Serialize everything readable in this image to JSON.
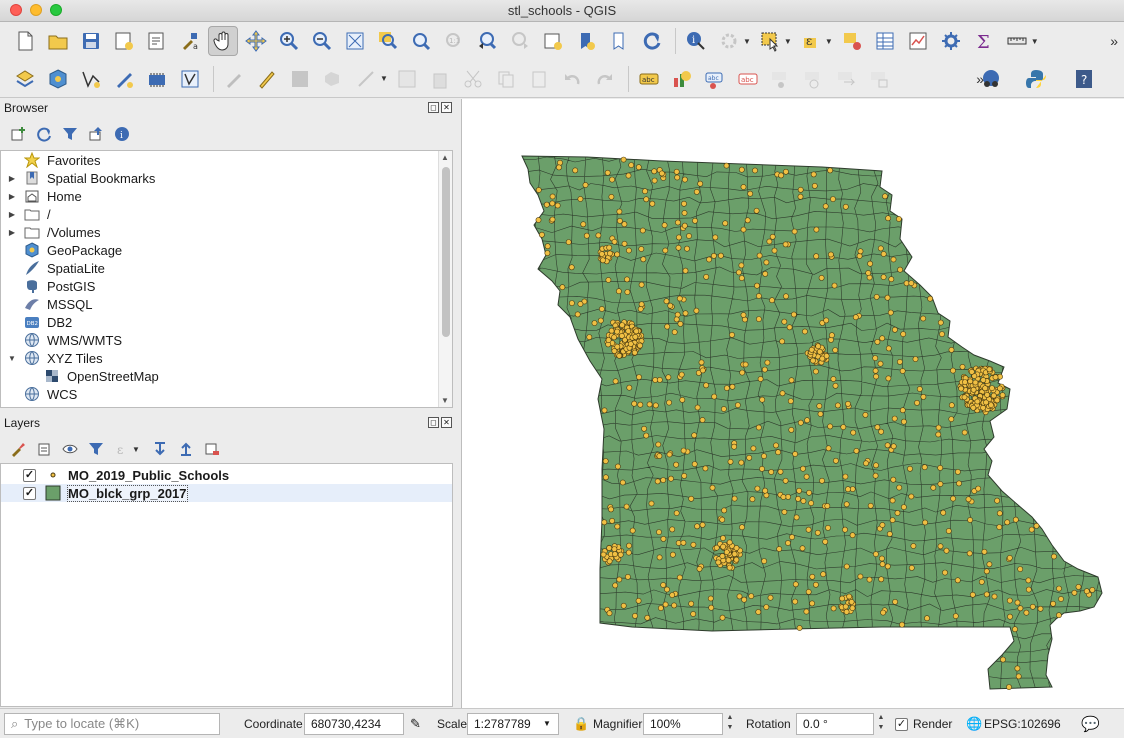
{
  "window": {
    "title": "stl_schools - QGIS"
  },
  "toolbar1": {
    "icons": [
      "new-project-icon",
      "open-project-icon",
      "save-project-icon",
      "new-print-layout-icon",
      "layout-manager-icon",
      "style-manager-icon",
      "pan-icon",
      "pan-to-selection-icon",
      "zoom-in-icon",
      "zoom-out-icon",
      "zoom-full-icon",
      "zoom-to-selection-icon",
      "zoom-to-layer-icon",
      "zoom-native-icon",
      "zoom-last-icon",
      "zoom-next-icon",
      "new-map-view-icon",
      "new-bookmark-icon",
      "show-bookmarks-icon",
      "refresh-icon",
      "identify-icon",
      "action-icon",
      "select-icon",
      "select-by-expression-icon",
      "deselect-icon",
      "attribute-table-icon",
      "statistics-icon",
      "toolbox-icon",
      "field-calculator-icon",
      "measure-icon"
    ]
  },
  "toolbar2": {
    "icons": [
      "data-source-manager-icon",
      "new-geopackage-layer-icon",
      "vertex-tool-icon",
      "digitize-icon",
      "new-temp-layer-icon",
      "virtual-layer-icon",
      "current-edits-icon",
      "toggle-editing-icon",
      "save-edits-icon",
      "add-feature-icon",
      "vertex-edit-icon",
      "modify-attributes-icon",
      "delete-selected-icon",
      "cut-icon",
      "copy-icon",
      "paste-icon",
      "undo-icon",
      "redo-icon",
      "label-icon",
      "diagram-icon",
      "pin-labels-icon",
      "highlight-pinned-icon",
      "move-label-icon",
      "rotate-label-icon",
      "change-label-icon",
      "show-hide-labels-icon",
      "plugin-icon",
      "python-icon",
      "help-icon"
    ]
  },
  "browser": {
    "title": "Browser",
    "items": [
      {
        "label": "Favorites",
        "icon": "star-icon",
        "arrow": ""
      },
      {
        "label": "Spatial Bookmarks",
        "icon": "bookmark-icon",
        "arrow": "▶"
      },
      {
        "label": "Home",
        "icon": "home-icon",
        "arrow": "▶"
      },
      {
        "label": "/",
        "icon": "folder-icon",
        "arrow": "▶"
      },
      {
        "label": "/Volumes",
        "icon": "folder-icon",
        "arrow": "▶"
      },
      {
        "label": "GeoPackage",
        "icon": "geopackage-icon",
        "arrow": ""
      },
      {
        "label": "SpatiaLite",
        "icon": "spatialite-icon",
        "arrow": ""
      },
      {
        "label": "PostGIS",
        "icon": "postgis-icon",
        "arrow": ""
      },
      {
        "label": "MSSQL",
        "icon": "mssql-icon",
        "arrow": ""
      },
      {
        "label": "DB2",
        "icon": "db2-icon",
        "arrow": ""
      },
      {
        "label": "WMS/WMTS",
        "icon": "globe-icon",
        "arrow": ""
      },
      {
        "label": "XYZ Tiles",
        "icon": "globe-icon",
        "arrow": "▼"
      },
      {
        "label": "OpenStreetMap",
        "icon": "osm-tiles-icon",
        "arrow": "",
        "indent": true
      },
      {
        "label": "WCS",
        "icon": "globe-icon",
        "arrow": ""
      }
    ],
    "db2_badge": "DB2"
  },
  "layers": {
    "title": "Layers",
    "items": [
      {
        "name": "MO_2019_Public_Schools",
        "checked": "✓",
        "symbol": "point"
      },
      {
        "name": "MO_blck_grp_2017",
        "checked": "✓",
        "symbol": "polygon"
      }
    ]
  },
  "statusbar": {
    "locate_placeholder": "Type to locate (⌘K)",
    "coordinate_label": "Coordinate",
    "coordinate_value": "680730,4234",
    "scale_label": "Scale",
    "scale_value": "1:2787789",
    "magnifier_label": "Magnifier",
    "magnifier_value": "100%",
    "rotation_label": "Rotation",
    "rotation_value": "0.0 °",
    "render_label": "Render",
    "render_checked": "✓",
    "crs_label": "EPSG:102696"
  },
  "map": {
    "fill_color": "#6b9f6a",
    "stroke_color": "#2e3b2c",
    "point_color": "#f0c044",
    "point_stroke": "#4a3a10"
  },
  "abc_text": "abc",
  "toolbar_chevron": "»"
}
